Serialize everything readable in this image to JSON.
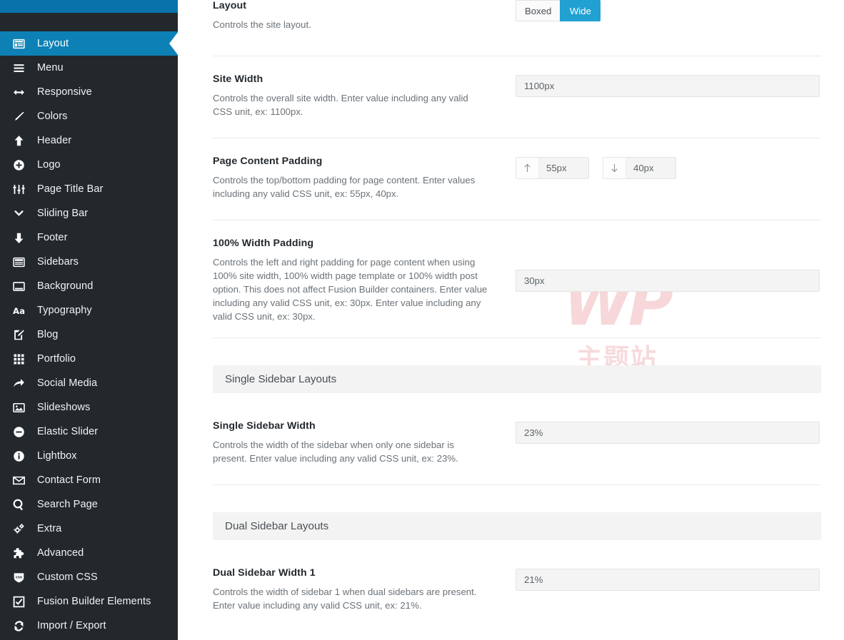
{
  "sidebar": {
    "items": [
      {
        "label": "Layout",
        "icon": "layout-icon",
        "active": true
      },
      {
        "label": "Menu",
        "icon": "menu-icon",
        "active": false
      },
      {
        "label": "Responsive",
        "icon": "arrows-h-icon",
        "active": false
      },
      {
        "label": "Colors",
        "icon": "brush-icon",
        "active": false
      },
      {
        "label": "Header",
        "icon": "arrow-up-icon",
        "active": false
      },
      {
        "label": "Logo",
        "icon": "plus-circle-icon",
        "active": false
      },
      {
        "label": "Page Title Bar",
        "icon": "sliders-icon",
        "active": false
      },
      {
        "label": "Sliding Bar",
        "icon": "chevron-down-icon",
        "active": false
      },
      {
        "label": "Footer",
        "icon": "arrow-down-icon",
        "active": false
      },
      {
        "label": "Sidebars",
        "icon": "sidebars-icon",
        "active": false
      },
      {
        "label": "Background",
        "icon": "background-icon",
        "active": false
      },
      {
        "label": "Typography",
        "icon": "typography-icon",
        "active": false
      },
      {
        "label": "Blog",
        "icon": "pencil-square-icon",
        "active": false
      },
      {
        "label": "Portfolio",
        "icon": "grid-icon",
        "active": false
      },
      {
        "label": "Social Media",
        "icon": "share-arrow-icon",
        "active": false
      },
      {
        "label": "Slideshows",
        "icon": "image-icon",
        "active": false
      },
      {
        "label": "Elastic Slider",
        "icon": "minus-circle-icon",
        "active": false
      },
      {
        "label": "Lightbox",
        "icon": "info-circle-icon",
        "active": false
      },
      {
        "label": "Contact Form",
        "icon": "envelope-icon",
        "active": false
      },
      {
        "label": "Search Page",
        "icon": "search-icon",
        "active": false
      },
      {
        "label": "Extra",
        "icon": "gears-icon",
        "active": false
      },
      {
        "label": "Advanced",
        "icon": "puzzle-icon",
        "active": false
      },
      {
        "label": "Custom CSS",
        "icon": "css-shield-icon",
        "active": false
      },
      {
        "label": "Fusion Builder Elements",
        "icon": "check-square-icon",
        "active": false
      },
      {
        "label": "Import / Export",
        "icon": "refresh-icon",
        "active": false
      }
    ]
  },
  "watermark": {
    "wordmark": "WP",
    "subtext": "主题站"
  },
  "fields": {
    "layout": {
      "title": "Layout",
      "desc": "Controls the site layout.",
      "options": [
        {
          "label": "Boxed",
          "selected": false
        },
        {
          "label": "Wide",
          "selected": true
        }
      ]
    },
    "site_width": {
      "title": "Site Width",
      "desc": "Controls the overall site width. Enter value including any valid CSS unit, ex: 1100px.",
      "value": "1100px"
    },
    "page_content_padding": {
      "title": "Page Content Padding",
      "desc": "Controls the top/bottom padding for page content. Enter values including any valid CSS unit, ex: 55px, 40px.",
      "top": {
        "icon": "arrow-up-icon",
        "value": "55px"
      },
      "bottom": {
        "icon": "arrow-down-icon",
        "value": "40px"
      }
    },
    "full_width_padding": {
      "title": "100% Width Padding",
      "desc": "Controls the left and right padding for page content when using 100% site width, 100% width page template or 100% width post option. This does not affect Fusion Builder containers. Enter value including any valid CSS unit, ex: 30px. Enter value including any valid CSS unit, ex: 30px.",
      "value": "30px"
    },
    "single_sidebar_width": {
      "title": "Single Sidebar Width",
      "desc": "Controls the width of the sidebar when only one sidebar is present. Enter value including any valid CSS unit, ex: 23%.",
      "value": "23%"
    },
    "dual_sidebar_width_1": {
      "title": "Dual Sidebar Width 1",
      "desc": "Controls the width of sidebar 1 when dual sidebars are present. Enter value including any valid CSS unit, ex: 21%.",
      "value": "21%"
    }
  },
  "sections": {
    "single_sidebar_layouts": "Single Sidebar Layouts",
    "dual_sidebar_layouts": "Dual Sidebar Layouts"
  },
  "colors": {
    "sidebar_bg": "#23282d",
    "accent": "#21a0d2",
    "active_item_bg": "#0d81b5",
    "top_bar": "#0773aa"
  }
}
